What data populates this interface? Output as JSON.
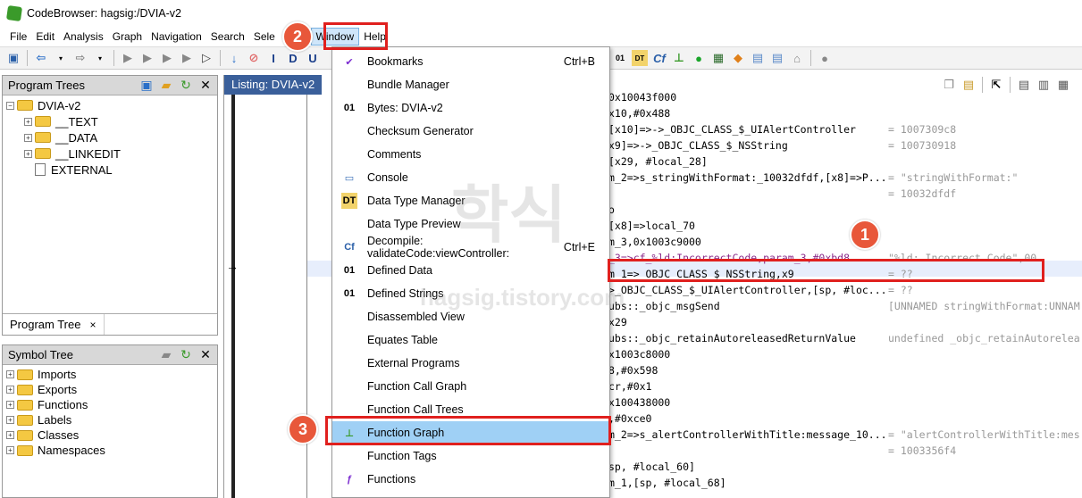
{
  "title": "CodeBrowser: hagsig:/DVIA-v2",
  "menubar": {
    "items": [
      "File",
      "Edit",
      "Analysis",
      "Graph",
      "Navigation",
      "Search",
      "Sele",
      "ls",
      "Window",
      "Help"
    ]
  },
  "program_trees": {
    "title": "Program Trees",
    "root": "DVIA-v2",
    "children": [
      "__TEXT",
      "__DATA",
      "__LINKEDIT",
      "EXTERNAL"
    ],
    "tab": "Program Tree",
    "tab_close": "×"
  },
  "symbol_tree": {
    "title": "Symbol Tree",
    "items": [
      "Imports",
      "Exports",
      "Functions",
      "Labels",
      "Classes",
      "Namespaces"
    ]
  },
  "listing": {
    "title": "Listing:  DVIA-v2",
    "lines": [
      {
        "code": "0x10043f000",
        "comment": ""
      },
      {
        "code": "x10,#0x488",
        "comment": ""
      },
      {
        "code": "[x10]=>->_OBJC_CLASS_$_UIAlertController",
        "comment": "= 1007309c8"
      },
      {
        "code": "x9]=>->_OBJC_CLASS_$_NSString",
        "comment": "= 100730918"
      },
      {
        "code": "[x29, #local_28]",
        "comment": ""
      },
      {
        "code": "m_2=>s_stringWithFormat:_10032dfdf,[x8]=>P...",
        "comment": "= \"stringWithFormat:\""
      },
      {
        "code": "",
        "comment": "= 10032dfdf"
      },
      {
        "code": "o",
        "comment": ""
      },
      {
        "code": "[x8]=>local_70",
        "comment": ""
      },
      {
        "code": "m_3,0x1003c9000",
        "comment": ""
      },
      {
        "code": "_3=>cf_%ld:IncorrectCode,param_3,#0xbd8",
        "comment": "\"%ld: Incorrect Code\",00"
      },
      {
        "code": "m_1=>_OBJC_CLASS_$_NSString,x9",
        "comment": "= ??"
      },
      {
        "code": ">_OBJC_CLASS_$_UIAlertController,[sp, #loc...",
        "comment": "= ??"
      },
      {
        "code": "ubs::_objc_msgSend",
        "comment": "[UNNAMED stringWithFormat:UNNAM"
      },
      {
        "code": "x29",
        "comment": ""
      },
      {
        "code": "ubs::_objc_retainAutoreleasedReturnValue",
        "comment": "undefined _objc_retainAutorelea"
      },
      {
        "code": "x1003c8000",
        "comment": ""
      },
      {
        "code": "8,#0x598",
        "comment": ""
      },
      {
        "code": "cr,#0x1",
        "comment": ""
      },
      {
        "code": "x100438000",
        "comment": ""
      },
      {
        "code": ",#0xce0",
        "comment": ""
      },
      {
        "code": "m_2=>s_alertControllerWithTitle:message_10...",
        "comment": "= \"alertControllerWithTitle:mes"
      },
      {
        "code": "",
        "comment": "= 1003356f4"
      },
      {
        "code": "sp, #local_60]",
        "comment": ""
      },
      {
        "code": "m_1,[sp, #local_68]",
        "comment": ""
      }
    ]
  },
  "window_menu": {
    "items": [
      {
        "label": "Bookmarks",
        "shortcut": "Ctrl+B",
        "icon": "check-icon"
      },
      {
        "label": "Bundle Manager",
        "shortcut": "",
        "icon": ""
      },
      {
        "label": "Bytes: DVIA-v2",
        "shortcut": "",
        "icon": "bytes-icon"
      },
      {
        "label": "Checksum Generator",
        "shortcut": "",
        "icon": ""
      },
      {
        "label": "Comments",
        "shortcut": "",
        "icon": ""
      },
      {
        "label": "Console",
        "shortcut": "",
        "icon": "monitor-icon"
      },
      {
        "label": "Data Type Manager",
        "shortcut": "",
        "icon": "datatype-icon"
      },
      {
        "label": "Data Type Preview",
        "shortcut": "",
        "icon": ""
      },
      {
        "label": "Decompile: validateCode:viewController:",
        "shortcut": "Ctrl+E",
        "icon": "decompile-icon"
      },
      {
        "label": "Defined Data",
        "shortcut": "",
        "icon": "data-icon"
      },
      {
        "label": "Defined Strings",
        "shortcut": "",
        "icon": "data-icon"
      },
      {
        "label": "Disassembled View",
        "shortcut": "",
        "icon": ""
      },
      {
        "label": "Equates Table",
        "shortcut": "",
        "icon": ""
      },
      {
        "label": "External Programs",
        "shortcut": "",
        "icon": ""
      },
      {
        "label": "Function Call Graph",
        "shortcut": "",
        "icon": ""
      },
      {
        "label": "Function Call Trees",
        "shortcut": "",
        "icon": ""
      },
      {
        "label": "Function Graph",
        "shortcut": "",
        "icon": "graph-icon"
      },
      {
        "label": "Function Tags",
        "shortcut": "",
        "icon": ""
      },
      {
        "label": "Functions",
        "shortcut": "",
        "icon": "functions-icon"
      }
    ]
  },
  "badges": [
    "1",
    "2",
    "3"
  ],
  "watermark": {
    "text": "hagsig.tistory.com",
    "kr": "학식"
  },
  "colors": {
    "accent": "#e0201e",
    "badge": "#e8573a",
    "selection": "#9fd0f5",
    "listing_header": "#3a5f9a"
  }
}
